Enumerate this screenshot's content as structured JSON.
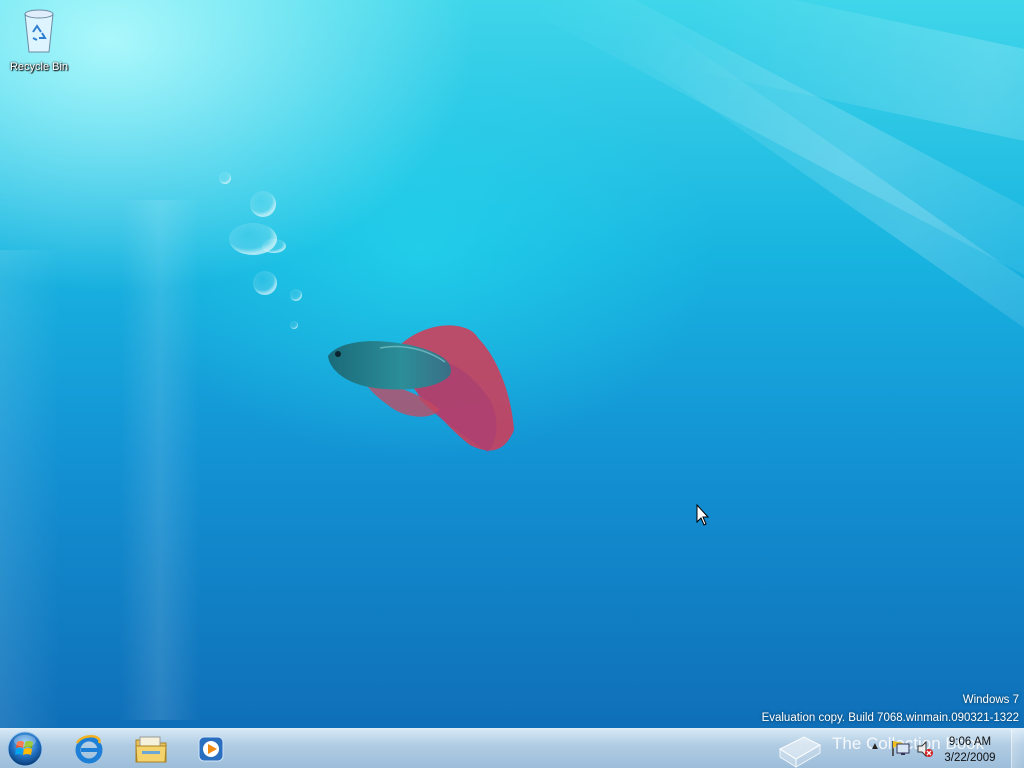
{
  "desktop": {
    "icons": [
      {
        "label": "Recycle Bin",
        "icon": "recycle-bin-icon"
      }
    ],
    "watermark": {
      "line1": "Windows 7",
      "line2": "Evaluation copy. Build 7068.winmain.090321-1322"
    }
  },
  "taskbar": {
    "pinned": [
      {
        "name": "internet-explorer",
        "icon": "internet-explorer-icon"
      },
      {
        "name": "windows-explorer",
        "icon": "folder-libraries-icon"
      },
      {
        "name": "media-player",
        "icon": "media-player-icon"
      }
    ],
    "tray": {
      "time": "9:06 AM",
      "date": "3/22/2009",
      "icons": [
        "show-hidden-icons-chevron",
        "action-center-flag-icon",
        "network-icon",
        "volume-icon"
      ]
    },
    "overlay_text": "The Collection Book"
  },
  "colors": {
    "desktop_light": "#3fd6ea",
    "desktop_dark": "#0f6fb8",
    "taskbar": "#aac8e1"
  }
}
